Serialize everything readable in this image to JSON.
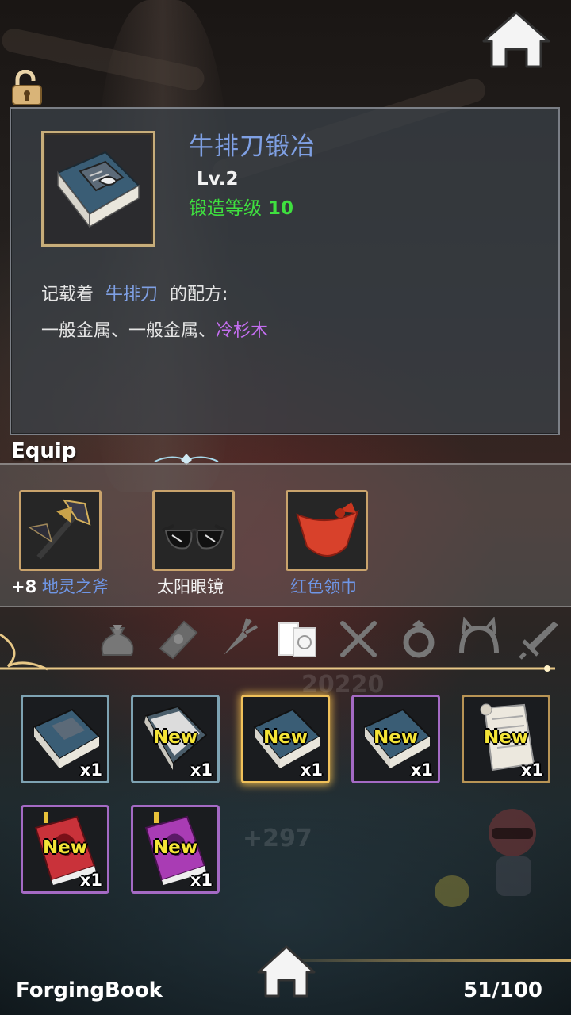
{
  "item": {
    "title": "牛排刀锻冶",
    "level": "Lv.2",
    "forge_level_label": "锻造等级",
    "forge_level_value": "10",
    "desc_prefix": "记载着",
    "desc_item": "牛排刀",
    "desc_suffix": "的配方:",
    "materials_plain": "一般金属、一般金属、",
    "materials_special": "冷杉木"
  },
  "equip": {
    "section_label": "Equip",
    "slots": [
      {
        "bonus": "+8",
        "name": "地灵之斧",
        "name_color": "#6f96e6"
      },
      {
        "bonus": "",
        "name": "太阳眼镜",
        "name_color": "#f2f2f2"
      },
      {
        "bonus": "",
        "name": "红色领巾",
        "name_color": "#6f96e6"
      }
    ]
  },
  "tabs": [
    "bag-icon",
    "card-icon",
    "carrot-icon",
    "books-icon",
    "fork-knife-icon",
    "ring-icon",
    "headband-icon",
    "sword-icon"
  ],
  "inventory": [
    {
      "new": "",
      "count": "x1",
      "border": "#7ea3b3"
    },
    {
      "new": "New",
      "count": "x1",
      "border": "#7ea3b3"
    },
    {
      "new": "New",
      "count": "x1",
      "border": "#f0c15a"
    },
    {
      "new": "New",
      "count": "x1",
      "border": "#a46ac4"
    },
    {
      "new": "New",
      "count": "x1",
      "border": "#b89455"
    },
    {
      "new": "New",
      "count": "x1",
      "border": "#a46ac4"
    },
    {
      "new": "New",
      "count": "x1",
      "border": "#a46ac4"
    }
  ],
  "background_text": {
    "score": "20220",
    "gain": "+297"
  },
  "footer": {
    "title": "ForgingBook",
    "count": "51/100"
  }
}
